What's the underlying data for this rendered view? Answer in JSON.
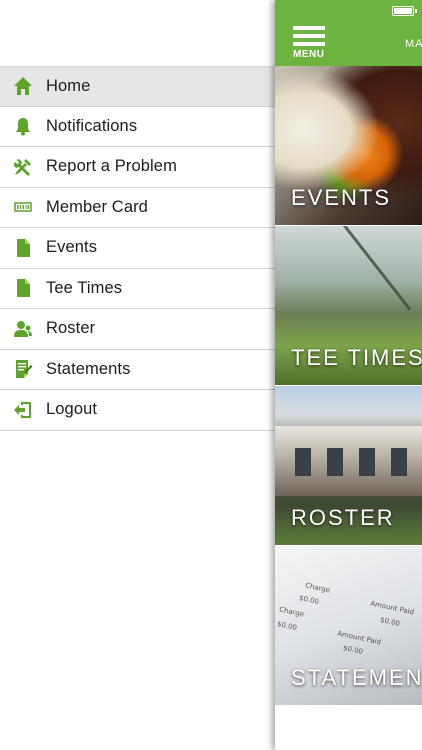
{
  "menu": {
    "items": [
      {
        "label": "Home",
        "icon": "home-icon",
        "active": true
      },
      {
        "label": "Notifications",
        "icon": "bell-icon",
        "active": false
      },
      {
        "label": "Report a Problem",
        "icon": "tools-icon",
        "active": false
      },
      {
        "label": "Member Card",
        "icon": "barcode-icon",
        "active": false
      },
      {
        "label": "Events",
        "icon": "document-icon",
        "active": false
      },
      {
        "label": "Tee Times",
        "icon": "document-icon",
        "active": false
      },
      {
        "label": "Roster",
        "icon": "people-icon",
        "active": false
      },
      {
        "label": "Statements",
        "icon": "statement-icon",
        "active": false
      },
      {
        "label": "Logout",
        "icon": "logout-icon",
        "active": false
      }
    ]
  },
  "topbar": {
    "menu_label": "MENU",
    "brand": "MA"
  },
  "tiles": [
    {
      "label": "EVENTS"
    },
    {
      "label": "TEE TIMES"
    },
    {
      "label": "ROSTER"
    },
    {
      "label": "STATEMENTS"
    }
  ],
  "statement_preview": {
    "charge_1": "Charge",
    "amount_1": "$0.00",
    "charge_2": "Charge",
    "amount_2": "$0.00",
    "amount_paid_1": "Amount Paid",
    "amount_paid_value_1": "$0.00",
    "amount_paid_2": "Amount Paid",
    "amount_paid_value_2": "$0.00"
  },
  "colors": {
    "brand_green": "#6cb33f",
    "icon_green": "#5ea32b",
    "active_row": "#e6e6e6"
  }
}
